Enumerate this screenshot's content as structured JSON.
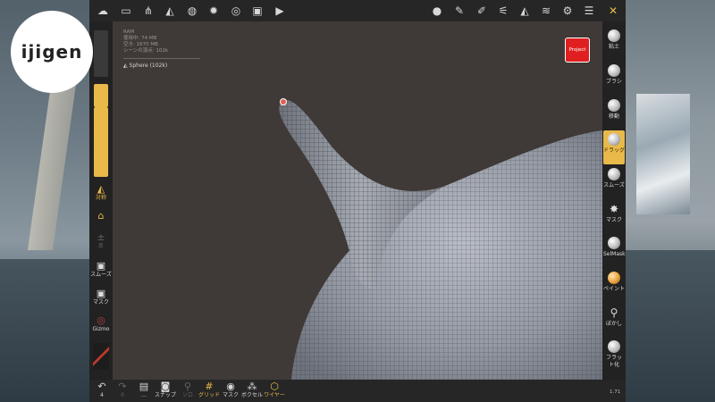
{
  "logo_text": "ijigen",
  "stats": {
    "ram": "RAM",
    "used": "使用中: 74 MB",
    "free": "空き: 1670 MB",
    "vertices": "シーンの頂点: 102k"
  },
  "scene": {
    "item_label": "Sphere (102k)"
  },
  "project_button": "Project",
  "left_panel": {
    "symmetry": "対称",
    "undo_vertical": "反",
    "smooth": "スムーズ",
    "mask": "マスク",
    "gizmo": "Gizmo",
    "radius_level": 0.42,
    "intensity_level": 0.98
  },
  "right_tools": [
    "粘土",
    "ブラシ",
    "移動",
    "ドラッグ",
    "スムーズ",
    "マスク",
    "SelMask",
    "ペイント",
    "ぼかし",
    "フラット化"
  ],
  "active_tool": "ドラッグ",
  "bottom": {
    "undo_count": "4",
    "redo_count": "0",
    "items": [
      "スナップ",
      "ソロ",
      "グリッド",
      "マスク",
      "ボクセル",
      "ワイヤー"
    ]
  },
  "footer_right": "1.71",
  "colors": {
    "accent": "#e9b949",
    "project": "#e02020",
    "mesh": "#8f949f"
  }
}
